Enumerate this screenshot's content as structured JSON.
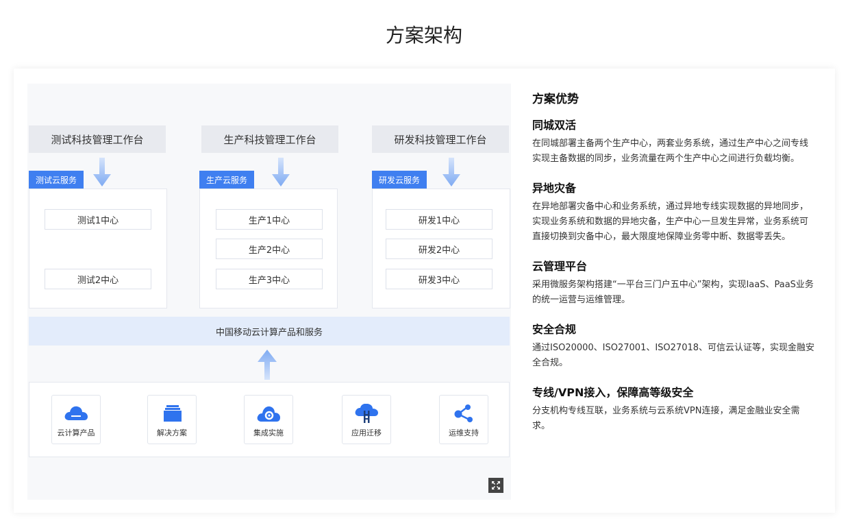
{
  "page_title": "方案架构",
  "diagram": {
    "workstations": [
      {
        "header": "测试科技管理工作台",
        "tag": "测试云服务",
        "centers": [
          "测试1中心",
          "测试2中心"
        ]
      },
      {
        "header": "生产科技管理工作台",
        "tag": "生产云服务",
        "centers": [
          "生产1中心",
          "生产2中心",
          "生产3中心"
        ]
      },
      {
        "header": "研发科技管理工作台",
        "tag": "研发云服务",
        "centers": [
          "研发1中心",
          "研发2中心",
          "研发3中心"
        ]
      }
    ],
    "platform": "中国移动云计算产品和服务",
    "services": [
      {
        "label": "云计算产品",
        "icon": "cloud-icon"
      },
      {
        "label": "解决方案",
        "icon": "stack-icon"
      },
      {
        "label": "集成实施",
        "icon": "cloud-gear-icon"
      },
      {
        "label": "应用迁移",
        "icon": "cloud-migrate-icon"
      },
      {
        "label": "运维支持",
        "icon": "share-nodes-icon"
      }
    ],
    "expand_icon": "expand-icon",
    "colors": {
      "accent": "#3f7ff0",
      "arrow": "#8fb6f5",
      "platform_bg": "#e3ecfb"
    }
  },
  "advantages": {
    "title": "方案优势",
    "sections": [
      {
        "title": "同城双活",
        "text": "在同城部署主备两个生产中心，两套业务系统，通过生产中心之间专线实现主备数据的同步，业务流量在两个生产中心之间进行负载均衡。"
      },
      {
        "title": "异地灾备",
        "text": "在异地部署灾备中心和业务系统，通过异地专线实现数据的异地同步，实现业务系统和数据的异地灾备，生产中心一旦发生异常，业务系统可直接切换到灾备中心，最大限度地保障业务零中断、数据零丢失。"
      },
      {
        "title": "云管理平台",
        "text": "采用微服务架构搭建“一平台三门户五中心”架构，实现IaaS、PaaS业务的统一运营与运维管理。"
      },
      {
        "title": "安全合规",
        "text": "通过ISO20000、ISO27001、ISO27018、可信云认证等，实现金融安全合规。"
      },
      {
        "title": "专线/VPN接入，保障高等级安全",
        "text": "分支机构专线互联，业务系统与云系统VPN连接，满足金融业安全需求。"
      }
    ]
  }
}
